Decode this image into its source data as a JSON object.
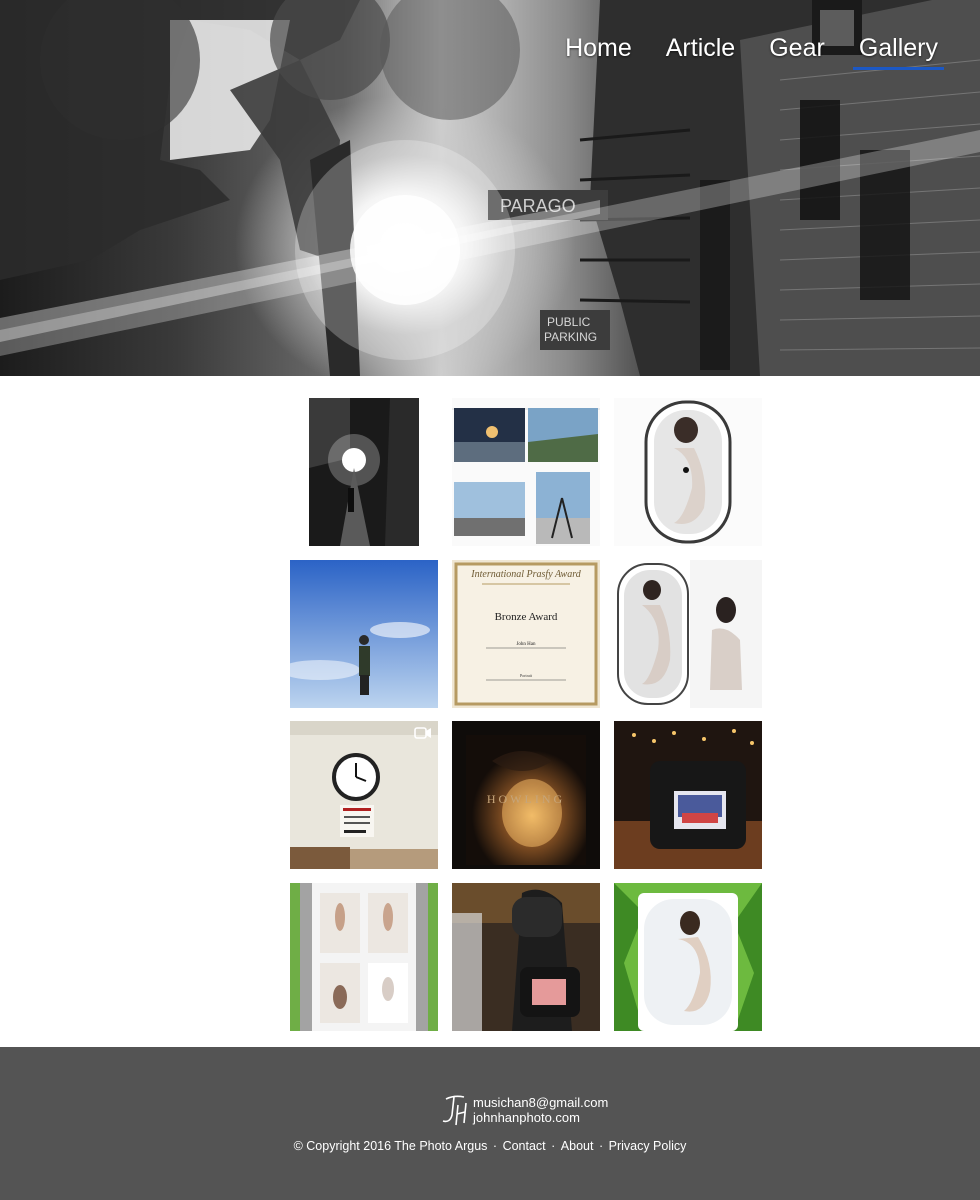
{
  "nav": {
    "items": [
      {
        "label": "Home",
        "active": false
      },
      {
        "label": "Article",
        "active": false
      },
      {
        "label": "Gear",
        "active": false
      },
      {
        "label": "Gallery",
        "active": true
      }
    ],
    "active_color": "#1c58c4"
  },
  "hero": {
    "signs": [
      "PARAGO",
      "PUBLIC",
      "PARKING"
    ]
  },
  "gallery": {
    "tiles": [
      {
        "name": "alley-night-photo"
      },
      {
        "name": "tripod-collage-photo"
      },
      {
        "name": "bathtub-portrait-photo"
      },
      {
        "name": "sky-man-photo"
      },
      {
        "name": "award-certificate-photo",
        "title": "International Prasfy Award",
        "award": "Bronze Award",
        "recipient": "John Han",
        "category": "Portrait"
      },
      {
        "name": "bathtub-diptych-photo"
      },
      {
        "name": "clock-wall-video",
        "has_video": true
      },
      {
        "name": "howling-poster-photo",
        "poster_text": "HOWLING"
      },
      {
        "name": "camera-bar-photo"
      },
      {
        "name": "model-grid-photo"
      },
      {
        "name": "camera-crowd-photo"
      },
      {
        "name": "bathtub-green-photo"
      }
    ]
  },
  "footer": {
    "email": "musichan8@gmail.com",
    "website": "johnhanphoto.com",
    "copyright": "© Copyright 2016 The Photo Argus",
    "links": [
      "Contact",
      "About",
      "Privacy Policy"
    ],
    "background": "#545454"
  }
}
